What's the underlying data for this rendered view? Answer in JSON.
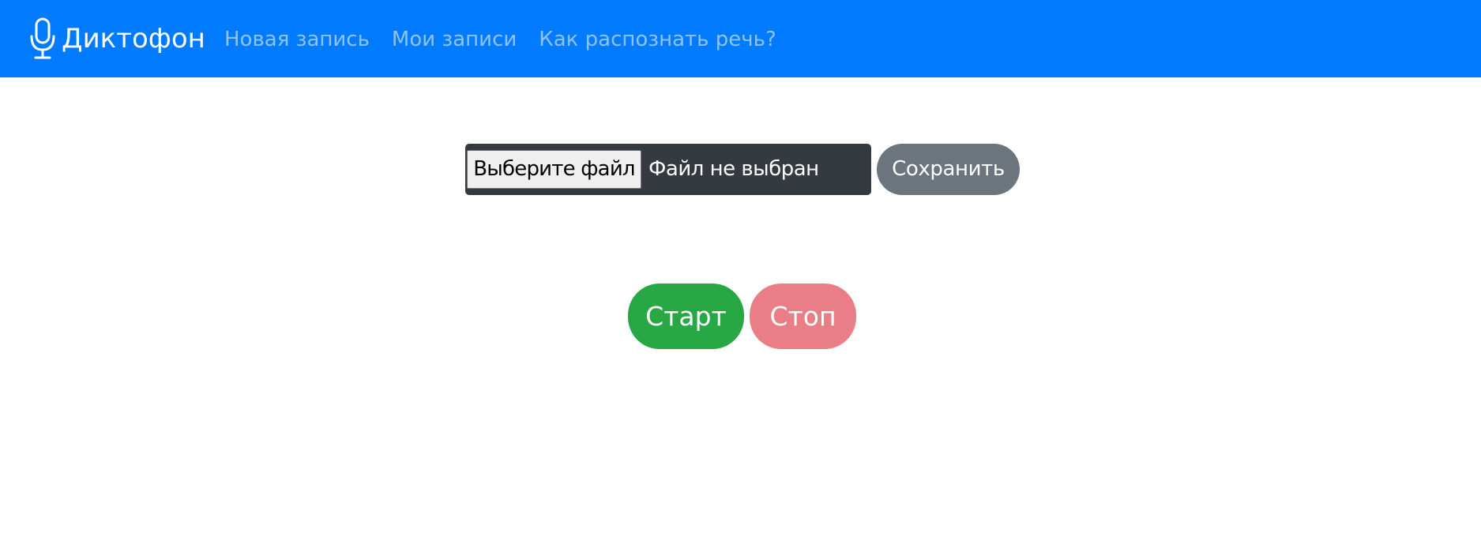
{
  "navbar": {
    "brand": {
      "icon": "microphone-icon",
      "label": "Диктофон"
    },
    "links": [
      {
        "label": "Новая запись"
      },
      {
        "label": "Мои записи"
      },
      {
        "label": "Как распознать речь?"
      }
    ],
    "colors": {
      "background": "#007bff",
      "link": "rgba(255,255,255,0.55)"
    }
  },
  "upload": {
    "choose_file_label": "Выберите файл",
    "file_status": "Файл не выбран",
    "save_label": "Сохранить"
  },
  "recorder": {
    "start_label": "Старт",
    "stop_label": "Стоп"
  },
  "colors": {
    "upload_box": "#343a40",
    "save_button": "#6c757d",
    "start_button": "#28a745",
    "stop_button": "#e97e87"
  }
}
